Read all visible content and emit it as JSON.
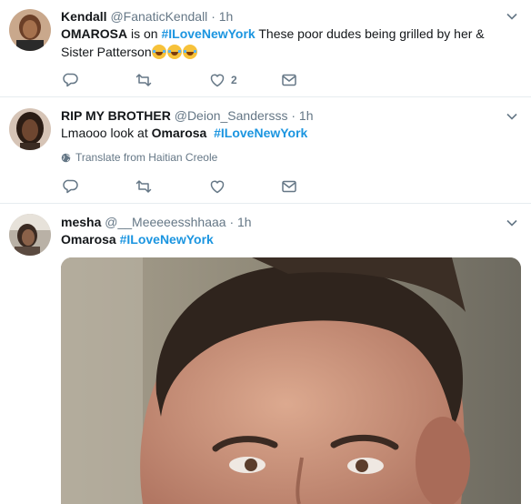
{
  "tweets": [
    {
      "name": "Kendall",
      "handle": "@FanaticKendall",
      "dot": "·",
      "time": "1h",
      "text_bold": "OMAROSA",
      "text_mid": " is on ",
      "hashtag": "#ILoveNewYork",
      "text_tail": " These poor dudes being grilled by her & Sister Patterson",
      "like_count": "2"
    },
    {
      "name": "RIP MY BROTHER",
      "handle": "@Deion_Sandersss",
      "dot": "·",
      "time": "1h",
      "text_pre": "Lmaooo look at ",
      "text_bold": "Omarosa",
      "hashtag": "#ILoveNewYork",
      "translate": "Translate from Haitian Creole"
    },
    {
      "name": "mesha",
      "handle": "@__Meeeeesshhaaa",
      "dot": "·",
      "time": "1h",
      "text_bold": "Omarosa",
      "hashtag": "#ILoveNewYork"
    }
  ],
  "colors": {
    "accent": "#1b95e0",
    "muted": "#657786",
    "divider": "#e6ecf0"
  },
  "icons": [
    "reply-icon",
    "retweet-icon",
    "like-icon",
    "message-icon",
    "chevron-down-icon",
    "globe-icon"
  ]
}
